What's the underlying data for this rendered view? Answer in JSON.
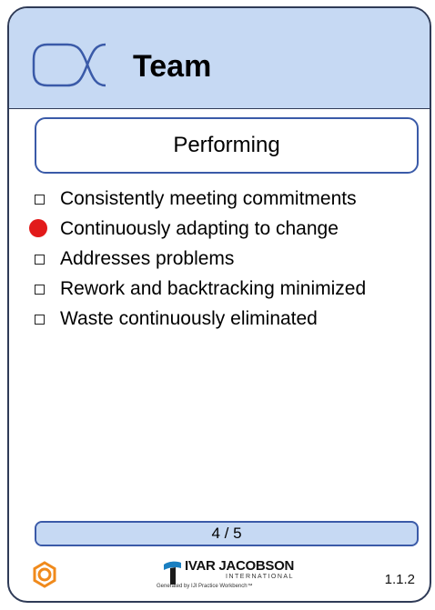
{
  "card": {
    "title": "Team",
    "icon": "alpha-icon"
  },
  "state": {
    "name": "Performing"
  },
  "checklist": [
    {
      "label": "Consistently meeting commitments",
      "marker": "checkbox"
    },
    {
      "label": "Continuously adapting to change",
      "marker": "red-dot"
    },
    {
      "label": "Addresses problems",
      "marker": "checkbox"
    },
    {
      "label": "Rework and backtracking minimized",
      "marker": "checkbox"
    },
    {
      "label": "Waste continuously eliminated",
      "marker": "checkbox"
    }
  ],
  "progress": {
    "label": "4 / 5",
    "value": 4,
    "total": 5
  },
  "footer": {
    "gear_icon": "gear-icon",
    "logo_name": "IVAR JACOBSON",
    "logo_sub": "INTERNATIONAL",
    "logo_generated": "Generated by IJI Practice Workbench™",
    "version": "1.1.2"
  },
  "colors": {
    "header_bg": "#c6d9f3",
    "border": "#2f3b57",
    "accent": "#3a5aa8",
    "red_marker": "#e21a1a",
    "gear": "#f08a1c"
  }
}
